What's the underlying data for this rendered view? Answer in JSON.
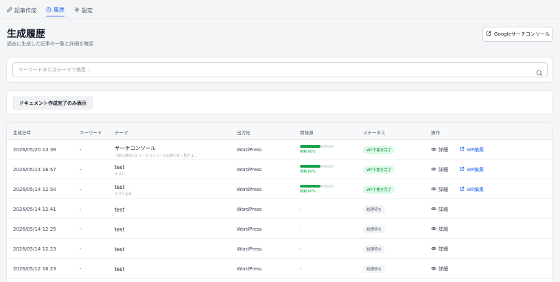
{
  "tabs": [
    {
      "label": "記事作成",
      "icon": "edit-icon"
    },
    {
      "label": "履歴",
      "icon": "clock-icon"
    },
    {
      "label": "設定",
      "icon": "gear-icon"
    }
  ],
  "header": {
    "title": "生成履歴",
    "subtitle": "過去に生成した記事の一覧と詳細を確認",
    "gsc_button": "Googleサーチコンソール"
  },
  "search": {
    "placeholder": "キーワードまたはテーマで検索...",
    "value": ""
  },
  "filter": {
    "button_label": "ドキュメント作成完了のみ表示"
  },
  "table": {
    "headers": [
      "生成日時",
      "キーワード",
      "テーマ",
      "出力先",
      "情報源",
      "ステータス",
      "操作"
    ],
    "detail_label": "詳細",
    "wp_edit_label": "WP編集",
    "rows": [
      {
        "date": "2026/05/20 13:38",
        "keyword": "-",
        "theme": "サーチコンソール",
        "theme_sub": "【初心者向け】サーチコンソールの使い方・見方 1...",
        "output": "WordPress",
        "source_label": "検索:60%",
        "source_pct": 60,
        "status": "WP下書き完了",
        "status_type": "done",
        "wp_edit": true
      },
      {
        "date": "2026/05/14 16:57",
        "keyword": "-",
        "theme": "test",
        "theme_sub": "テスト",
        "output": "WordPress",
        "source_label": "検索:60%",
        "source_pct": 60,
        "status": "WP下書き完了",
        "status_type": "done",
        "wp_edit": true
      },
      {
        "date": "2026/05/14 12:50",
        "keyword": "-",
        "theme": "test",
        "theme_sub": "テスト記事",
        "output": "WordPress",
        "source_label": "検索:60%",
        "source_pct": 60,
        "status": "WP下書き完了",
        "status_type": "done",
        "wp_edit": true
      },
      {
        "date": "2026/05/14 12:41",
        "keyword": "-",
        "theme": "test",
        "theme_sub": "",
        "output": "WordPress",
        "source_label": "-",
        "source_pct": null,
        "status": "処理待ち",
        "status_type": "pending",
        "wp_edit": false
      },
      {
        "date": "2026/05/14 12:25",
        "keyword": "-",
        "theme": "test",
        "theme_sub": "",
        "output": "WordPress",
        "source_label": "-",
        "source_pct": null,
        "status": "処理待ち",
        "status_type": "pending",
        "wp_edit": false
      },
      {
        "date": "2026/05/14 12:23",
        "keyword": "-",
        "theme": "test",
        "theme_sub": "",
        "output": "WordPress",
        "source_label": "-",
        "source_pct": null,
        "status": "処理待ち",
        "status_type": "pending",
        "wp_edit": false
      },
      {
        "date": "2026/05/12 16:23",
        "keyword": "-",
        "theme": "test",
        "theme_sub": "",
        "output": "WordPress",
        "source_label": "-",
        "source_pct": null,
        "status": "処理待ち",
        "status_type": "pending",
        "wp_edit": false
      }
    ]
  },
  "colors": {
    "accent": "#2563eb",
    "success": "#16a34a",
    "success_bg": "#dcfce7"
  }
}
